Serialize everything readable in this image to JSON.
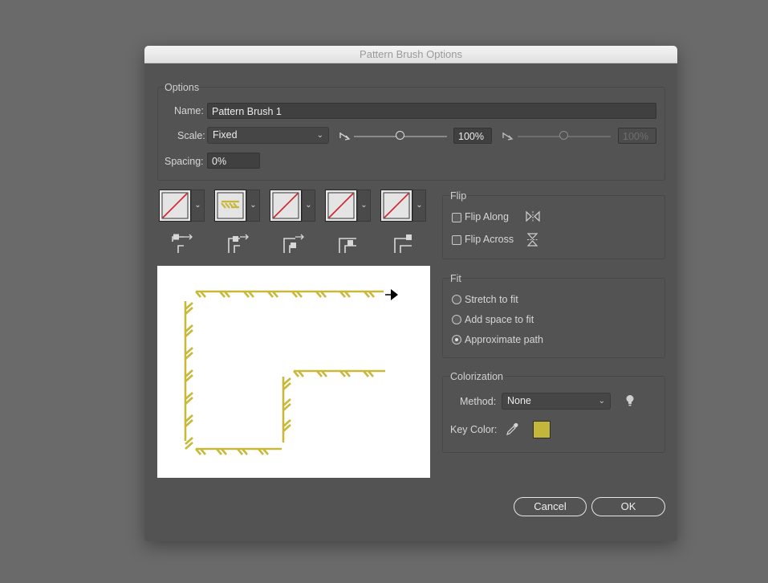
{
  "window": {
    "title": "Pattern Brush Options"
  },
  "options": {
    "group_title": "Options",
    "name_label": "Name:",
    "name_value": "Pattern Brush 1",
    "scale_label": "Scale:",
    "scale_value": "Fixed",
    "scale_pct": "100%",
    "scale_pct_disabled": "100%",
    "spacing_label": "Spacing:",
    "spacing_value": "0%"
  },
  "tiles": [
    {
      "name": "side-tile",
      "icon": "none-red-slash"
    },
    {
      "name": "outer-corner-tile",
      "icon": "pattern-hatch"
    },
    {
      "name": "inner-corner-tile",
      "icon": "none-red-slash"
    },
    {
      "name": "start-tile",
      "icon": "none-red-slash"
    },
    {
      "name": "end-tile",
      "icon": "none-red-slash"
    }
  ],
  "flip": {
    "group_title": "Flip",
    "along_label": "Flip Along",
    "along_checked": false,
    "across_label": "Flip Across",
    "across_checked": false
  },
  "fit": {
    "group_title": "Fit",
    "options": [
      "Stretch to fit",
      "Add space to fit",
      "Approximate path"
    ],
    "selected": "Approximate path"
  },
  "colorization": {
    "group_title": "Colorization",
    "method_label": "Method:",
    "method_value": "None",
    "key_color_label": "Key Color:",
    "key_color": "#c3b63a"
  },
  "buttons": {
    "cancel": "Cancel",
    "ok": "OK"
  },
  "colors": {
    "dialog_bg": "#535353",
    "pattern_color": "#c9b93a",
    "none_slash": "#d4202a"
  }
}
